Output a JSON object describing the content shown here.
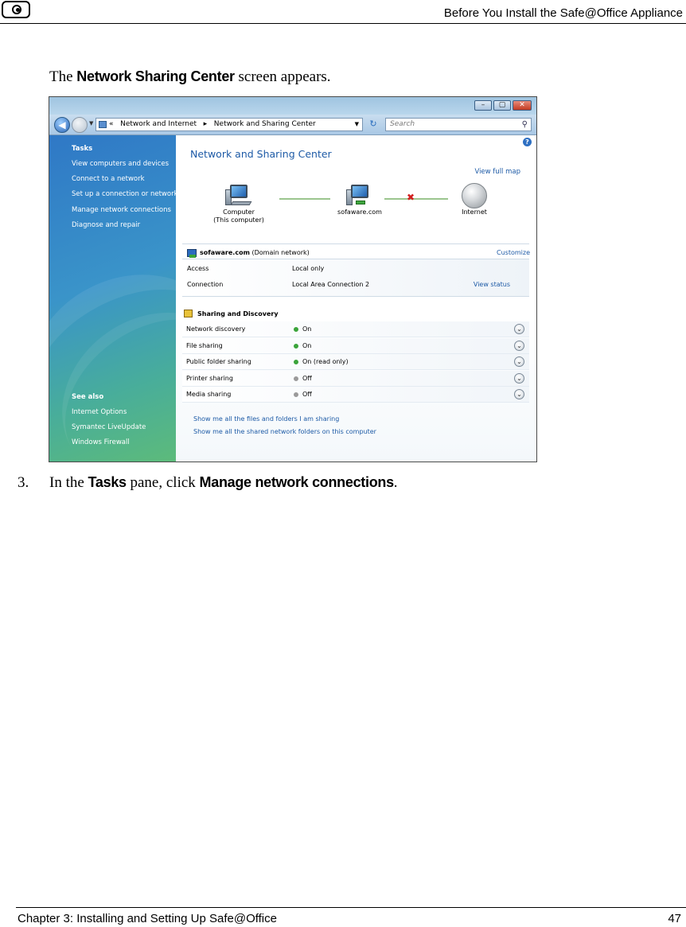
{
  "page_header": {
    "title": "Before You Install the Safe@Office Appliance"
  },
  "intro": {
    "prefix": "The ",
    "bold": "Network Sharing Center",
    "suffix": " screen appears."
  },
  "screenshot": {
    "address_bar": {
      "prefix": "«",
      "crumb1": "Network and Internet",
      "sep": "▸",
      "crumb2": "Network and Sharing Center"
    },
    "search_placeholder": "Search",
    "tasks": {
      "header": "Tasks",
      "items": [
        "View computers and devices",
        "Connect to a network",
        "Set up a connection or network",
        "Manage network connections",
        "Diagnose and repair"
      ],
      "see_also_header": "See also",
      "see_also": [
        "Internet Options",
        "Symantec LiveUpdate",
        "Windows Firewall"
      ]
    },
    "content": {
      "title": "Network and Sharing Center",
      "view_full_map": "View full map",
      "map": {
        "computer_line1": "Computer",
        "computer_line2": "(This computer)",
        "network": "sofaware.com",
        "internet": "Internet"
      },
      "network": {
        "name": "sofaware.com",
        "type": "(Domain network)",
        "customize": "Customize",
        "rows": [
          {
            "label": "Access",
            "value": "Local only",
            "action": ""
          },
          {
            "label": "Connection",
            "value": "Local Area Connection 2",
            "action": "View status"
          }
        ]
      },
      "sharing": {
        "header": "Sharing and Discovery",
        "rows": [
          {
            "label": "Network discovery",
            "value": "On",
            "state_color": "#3aa43a"
          },
          {
            "label": "File sharing",
            "value": "On",
            "state_color": "#3aa43a"
          },
          {
            "label": "Public folder sharing",
            "value": "On (read only)",
            "state_color": "#3aa43a"
          },
          {
            "label": "Printer sharing",
            "value": "Off",
            "state_color": "#9a9a9a"
          },
          {
            "label": "Media sharing",
            "value": "Off",
            "state_color": "#9a9a9a"
          }
        ]
      },
      "bottom_links": [
        "Show me all the files and folders I am sharing",
        "Show me all the shared network folders on this computer"
      ]
    }
  },
  "step": {
    "number": "3.",
    "prefix": "In the ",
    "bold1": "Tasks",
    "middle": " pane, click ",
    "bold2": "Manage network connections",
    "suffix": "."
  },
  "footer": {
    "chapter": "Chapter 3: Installing and Setting Up Safe@Office",
    "page_number": "47"
  }
}
